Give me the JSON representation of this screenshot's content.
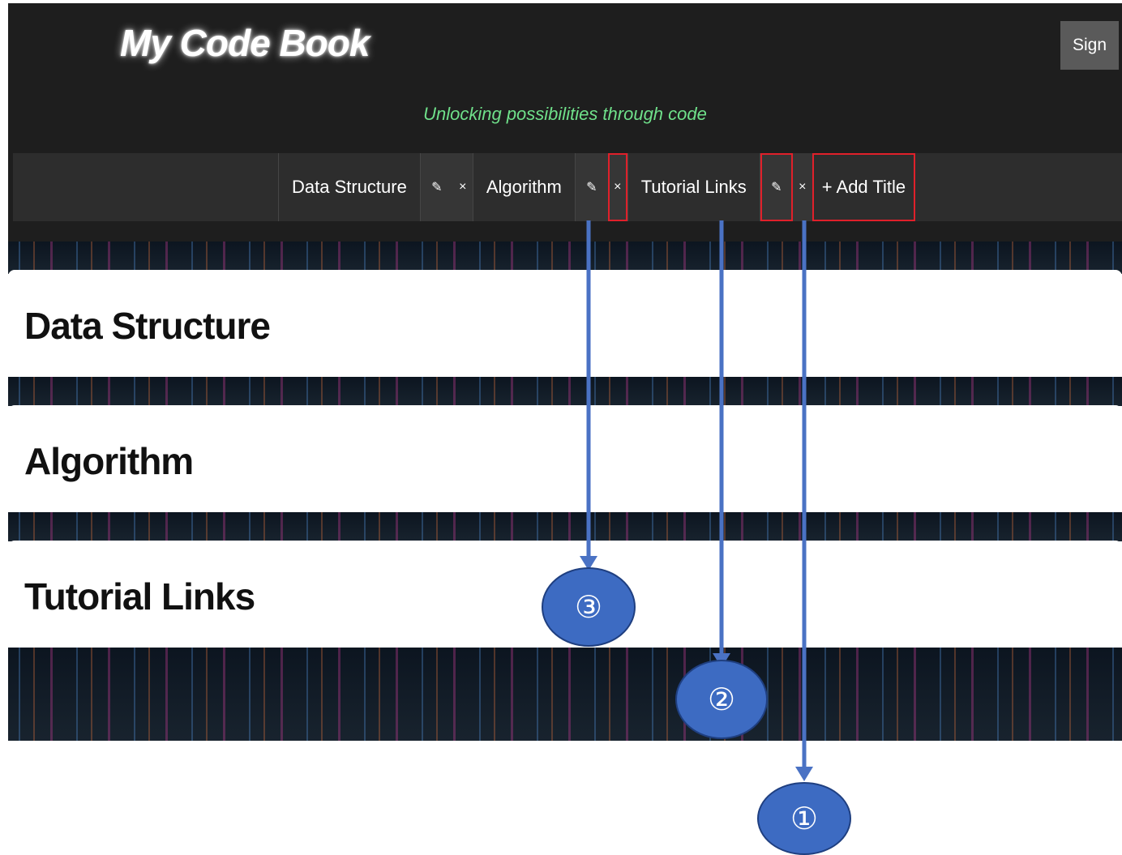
{
  "header": {
    "logo": "My Code Book",
    "sign_button": "Sign",
    "tagline": "Unlocking possibilities through code"
  },
  "nav": {
    "tabs": [
      {
        "label": "Data Structure",
        "edit_icon": "pencil-icon",
        "delete_label": "×"
      },
      {
        "label": "Algorithm",
        "edit_icon": "pencil-icon",
        "delete_label": "×"
      },
      {
        "label": "Tutorial Links",
        "edit_icon": "pencil-icon",
        "delete_label": "×"
      }
    ],
    "add_title": "+ Add Title"
  },
  "sections": [
    {
      "title": "Data Structure"
    },
    {
      "title": "Algorithm"
    },
    {
      "title": "Tutorial Links"
    }
  ],
  "annotations": {
    "callout_1": "①",
    "callout_2": "②",
    "callout_3": "③",
    "highlight_color": "#e0202a",
    "arrow_color": "#4a72c4",
    "callout_fill": "#3d6bc2"
  }
}
